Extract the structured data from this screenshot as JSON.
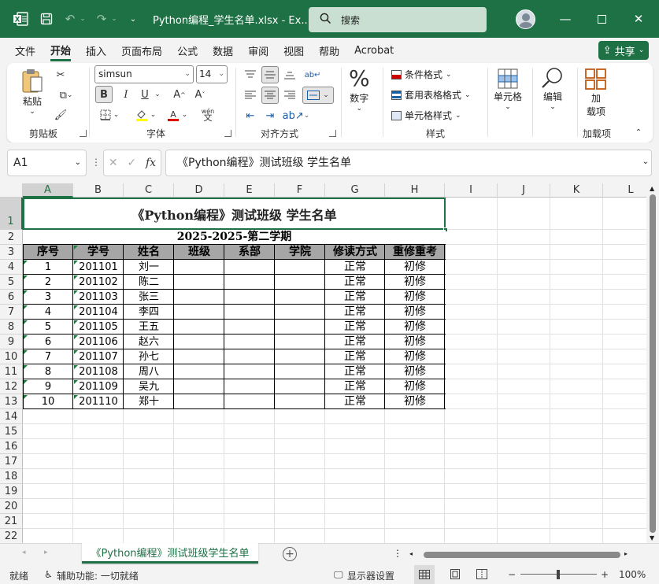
{
  "titlebar": {
    "file_title": "Python编程_学生名单.xlsx  -  Ex...",
    "search_placeholder": "搜索",
    "undo_icon": "undo-icon",
    "redo_icon": "redo-icon",
    "accent_color": "#1e7145"
  },
  "menu": {
    "tabs": [
      "文件",
      "开始",
      "插入",
      "页面布局",
      "公式",
      "数据",
      "审阅",
      "视图",
      "帮助",
      "Acrobat"
    ],
    "active_tab": "开始",
    "share_label": "共享"
  },
  "ribbon": {
    "clipboard": {
      "paste_label": "粘贴",
      "group_label": "剪贴板"
    },
    "font": {
      "font_name": "simsun",
      "font_size": "14",
      "group_label": "字体",
      "bold": "B",
      "italic": "I",
      "underline": "U"
    },
    "alignment": {
      "group_label": "对齐方式"
    },
    "number": {
      "label": "数字",
      "icon": "%"
    },
    "styles": {
      "conditional_format": "条件格式",
      "table_format": "套用表格格式",
      "cell_styles": "单元格样式",
      "group_label": "样式"
    },
    "cells": {
      "label": "单元格"
    },
    "editing": {
      "label": "编辑"
    },
    "addins": {
      "label_line1": "加",
      "label_line2": "载项",
      "group_label": "加载项"
    }
  },
  "formula_bar": {
    "name_box": "A1",
    "fx": "fx",
    "formula": "《Python编程》测试班级  学生名单"
  },
  "grid": {
    "columns": [
      "A",
      "B",
      "C",
      "D",
      "E",
      "F",
      "G",
      "H",
      "I",
      "J",
      "K",
      "L"
    ],
    "rows": [
      "1",
      "2",
      "3",
      "4",
      "5",
      "6",
      "7",
      "8",
      "9",
      "10",
      "11",
      "12",
      "13",
      "14",
      "15",
      "16",
      "17",
      "18",
      "19",
      "20",
      "21",
      "22"
    ],
    "selected_col": "A",
    "selected_row": "1"
  },
  "sheet": {
    "title": "《Python编程》测试班级    学生名单",
    "subtitle": "2025-2025-第二学期",
    "headers": [
      "序号",
      "学号",
      "姓名",
      "班级",
      "系部",
      "学院",
      "修读方式",
      "重修重考"
    ],
    "rows": [
      [
        "1",
        "201101",
        "刘一",
        "",
        "",
        "",
        "正常",
        "初修"
      ],
      [
        "2",
        "201102",
        "陈二",
        "",
        "",
        "",
        "正常",
        "初修"
      ],
      [
        "3",
        "201103",
        "张三",
        "",
        "",
        "",
        "正常",
        "初修"
      ],
      [
        "4",
        "201104",
        "李四",
        "",
        "",
        "",
        "正常",
        "初修"
      ],
      [
        "5",
        "201105",
        "王五",
        "",
        "",
        "",
        "正常",
        "初修"
      ],
      [
        "6",
        "201106",
        "赵六",
        "",
        "",
        "",
        "正常",
        "初修"
      ],
      [
        "7",
        "201107",
        "孙七",
        "",
        "",
        "",
        "正常",
        "初修"
      ],
      [
        "8",
        "201108",
        "周八",
        "",
        "",
        "",
        "正常",
        "初修"
      ],
      [
        "9",
        "201109",
        "吴九",
        "",
        "",
        "",
        "正常",
        "初修"
      ],
      [
        "10",
        "201110",
        "郑十",
        "",
        "",
        "",
        "正常",
        "初修"
      ]
    ],
    "header_fill": "#a6a6a6"
  },
  "tabs": {
    "sheet_name": "《Python编程》测试班级学生名单",
    "add_icon": "plus-circle-icon"
  },
  "status": {
    "ready": "就绪",
    "accessibility": "辅助功能: 一切就绪",
    "display_settings": "显示器设置",
    "zoom": "100%"
  }
}
